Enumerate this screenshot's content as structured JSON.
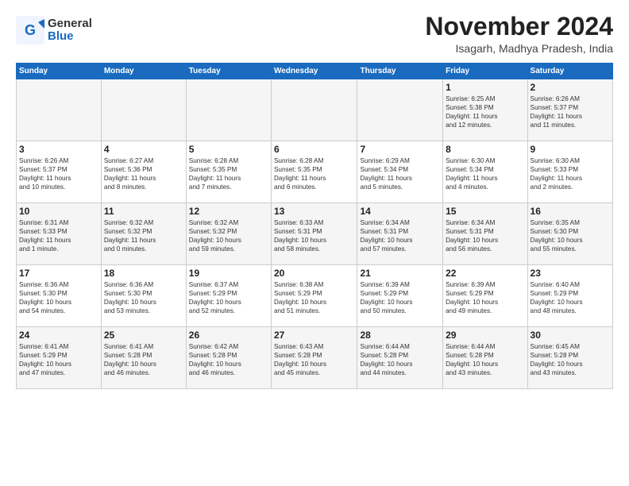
{
  "logo": {
    "general": "General",
    "blue": "Blue"
  },
  "title": "November 2024",
  "location": "Isagarh, Madhya Pradesh, India",
  "headers": [
    "Sunday",
    "Monday",
    "Tuesday",
    "Wednesday",
    "Thursday",
    "Friday",
    "Saturday"
  ],
  "weeks": [
    [
      {
        "day": "",
        "content": ""
      },
      {
        "day": "",
        "content": ""
      },
      {
        "day": "",
        "content": ""
      },
      {
        "day": "",
        "content": ""
      },
      {
        "day": "",
        "content": ""
      },
      {
        "day": "1",
        "content": "Sunrise: 6:25 AM\nSunset: 5:38 PM\nDaylight: 11 hours\nand 12 minutes."
      },
      {
        "day": "2",
        "content": "Sunrise: 6:26 AM\nSunset: 5:37 PM\nDaylight: 11 hours\nand 11 minutes."
      }
    ],
    [
      {
        "day": "3",
        "content": "Sunrise: 6:26 AM\nSunset: 5:37 PM\nDaylight: 11 hours\nand 10 minutes."
      },
      {
        "day": "4",
        "content": "Sunrise: 6:27 AM\nSunset: 5:36 PM\nDaylight: 11 hours\nand 8 minutes."
      },
      {
        "day": "5",
        "content": "Sunrise: 6:28 AM\nSunset: 5:35 PM\nDaylight: 11 hours\nand 7 minutes."
      },
      {
        "day": "6",
        "content": "Sunrise: 6:28 AM\nSunset: 5:35 PM\nDaylight: 11 hours\nand 6 minutes."
      },
      {
        "day": "7",
        "content": "Sunrise: 6:29 AM\nSunset: 5:34 PM\nDaylight: 11 hours\nand 5 minutes."
      },
      {
        "day": "8",
        "content": "Sunrise: 6:30 AM\nSunset: 5:34 PM\nDaylight: 11 hours\nand 4 minutes."
      },
      {
        "day": "9",
        "content": "Sunrise: 6:30 AM\nSunset: 5:33 PM\nDaylight: 11 hours\nand 2 minutes."
      }
    ],
    [
      {
        "day": "10",
        "content": "Sunrise: 6:31 AM\nSunset: 5:33 PM\nDaylight: 11 hours\nand 1 minute."
      },
      {
        "day": "11",
        "content": "Sunrise: 6:32 AM\nSunset: 5:32 PM\nDaylight: 11 hours\nand 0 minutes."
      },
      {
        "day": "12",
        "content": "Sunrise: 6:32 AM\nSunset: 5:32 PM\nDaylight: 10 hours\nand 59 minutes."
      },
      {
        "day": "13",
        "content": "Sunrise: 6:33 AM\nSunset: 5:31 PM\nDaylight: 10 hours\nand 58 minutes."
      },
      {
        "day": "14",
        "content": "Sunrise: 6:34 AM\nSunset: 5:31 PM\nDaylight: 10 hours\nand 57 minutes."
      },
      {
        "day": "15",
        "content": "Sunrise: 6:34 AM\nSunset: 5:31 PM\nDaylight: 10 hours\nand 56 minutes."
      },
      {
        "day": "16",
        "content": "Sunrise: 6:35 AM\nSunset: 5:30 PM\nDaylight: 10 hours\nand 55 minutes."
      }
    ],
    [
      {
        "day": "17",
        "content": "Sunrise: 6:36 AM\nSunset: 5:30 PM\nDaylight: 10 hours\nand 54 minutes."
      },
      {
        "day": "18",
        "content": "Sunrise: 6:36 AM\nSunset: 5:30 PM\nDaylight: 10 hours\nand 53 minutes."
      },
      {
        "day": "19",
        "content": "Sunrise: 6:37 AM\nSunset: 5:29 PM\nDaylight: 10 hours\nand 52 minutes."
      },
      {
        "day": "20",
        "content": "Sunrise: 6:38 AM\nSunset: 5:29 PM\nDaylight: 10 hours\nand 51 minutes."
      },
      {
        "day": "21",
        "content": "Sunrise: 6:39 AM\nSunset: 5:29 PM\nDaylight: 10 hours\nand 50 minutes."
      },
      {
        "day": "22",
        "content": "Sunrise: 6:39 AM\nSunset: 5:29 PM\nDaylight: 10 hours\nand 49 minutes."
      },
      {
        "day": "23",
        "content": "Sunrise: 6:40 AM\nSunset: 5:29 PM\nDaylight: 10 hours\nand 48 minutes."
      }
    ],
    [
      {
        "day": "24",
        "content": "Sunrise: 6:41 AM\nSunset: 5:29 PM\nDaylight: 10 hours\nand 47 minutes."
      },
      {
        "day": "25",
        "content": "Sunrise: 6:41 AM\nSunset: 5:28 PM\nDaylight: 10 hours\nand 46 minutes."
      },
      {
        "day": "26",
        "content": "Sunrise: 6:42 AM\nSunset: 5:28 PM\nDaylight: 10 hours\nand 46 minutes."
      },
      {
        "day": "27",
        "content": "Sunrise: 6:43 AM\nSunset: 5:28 PM\nDaylight: 10 hours\nand 45 minutes."
      },
      {
        "day": "28",
        "content": "Sunrise: 6:44 AM\nSunset: 5:28 PM\nDaylight: 10 hours\nand 44 minutes."
      },
      {
        "day": "29",
        "content": "Sunrise: 6:44 AM\nSunset: 5:28 PM\nDaylight: 10 hours\nand 43 minutes."
      },
      {
        "day": "30",
        "content": "Sunrise: 6:45 AM\nSunset: 5:28 PM\nDaylight: 10 hours\nand 43 minutes."
      }
    ]
  ]
}
